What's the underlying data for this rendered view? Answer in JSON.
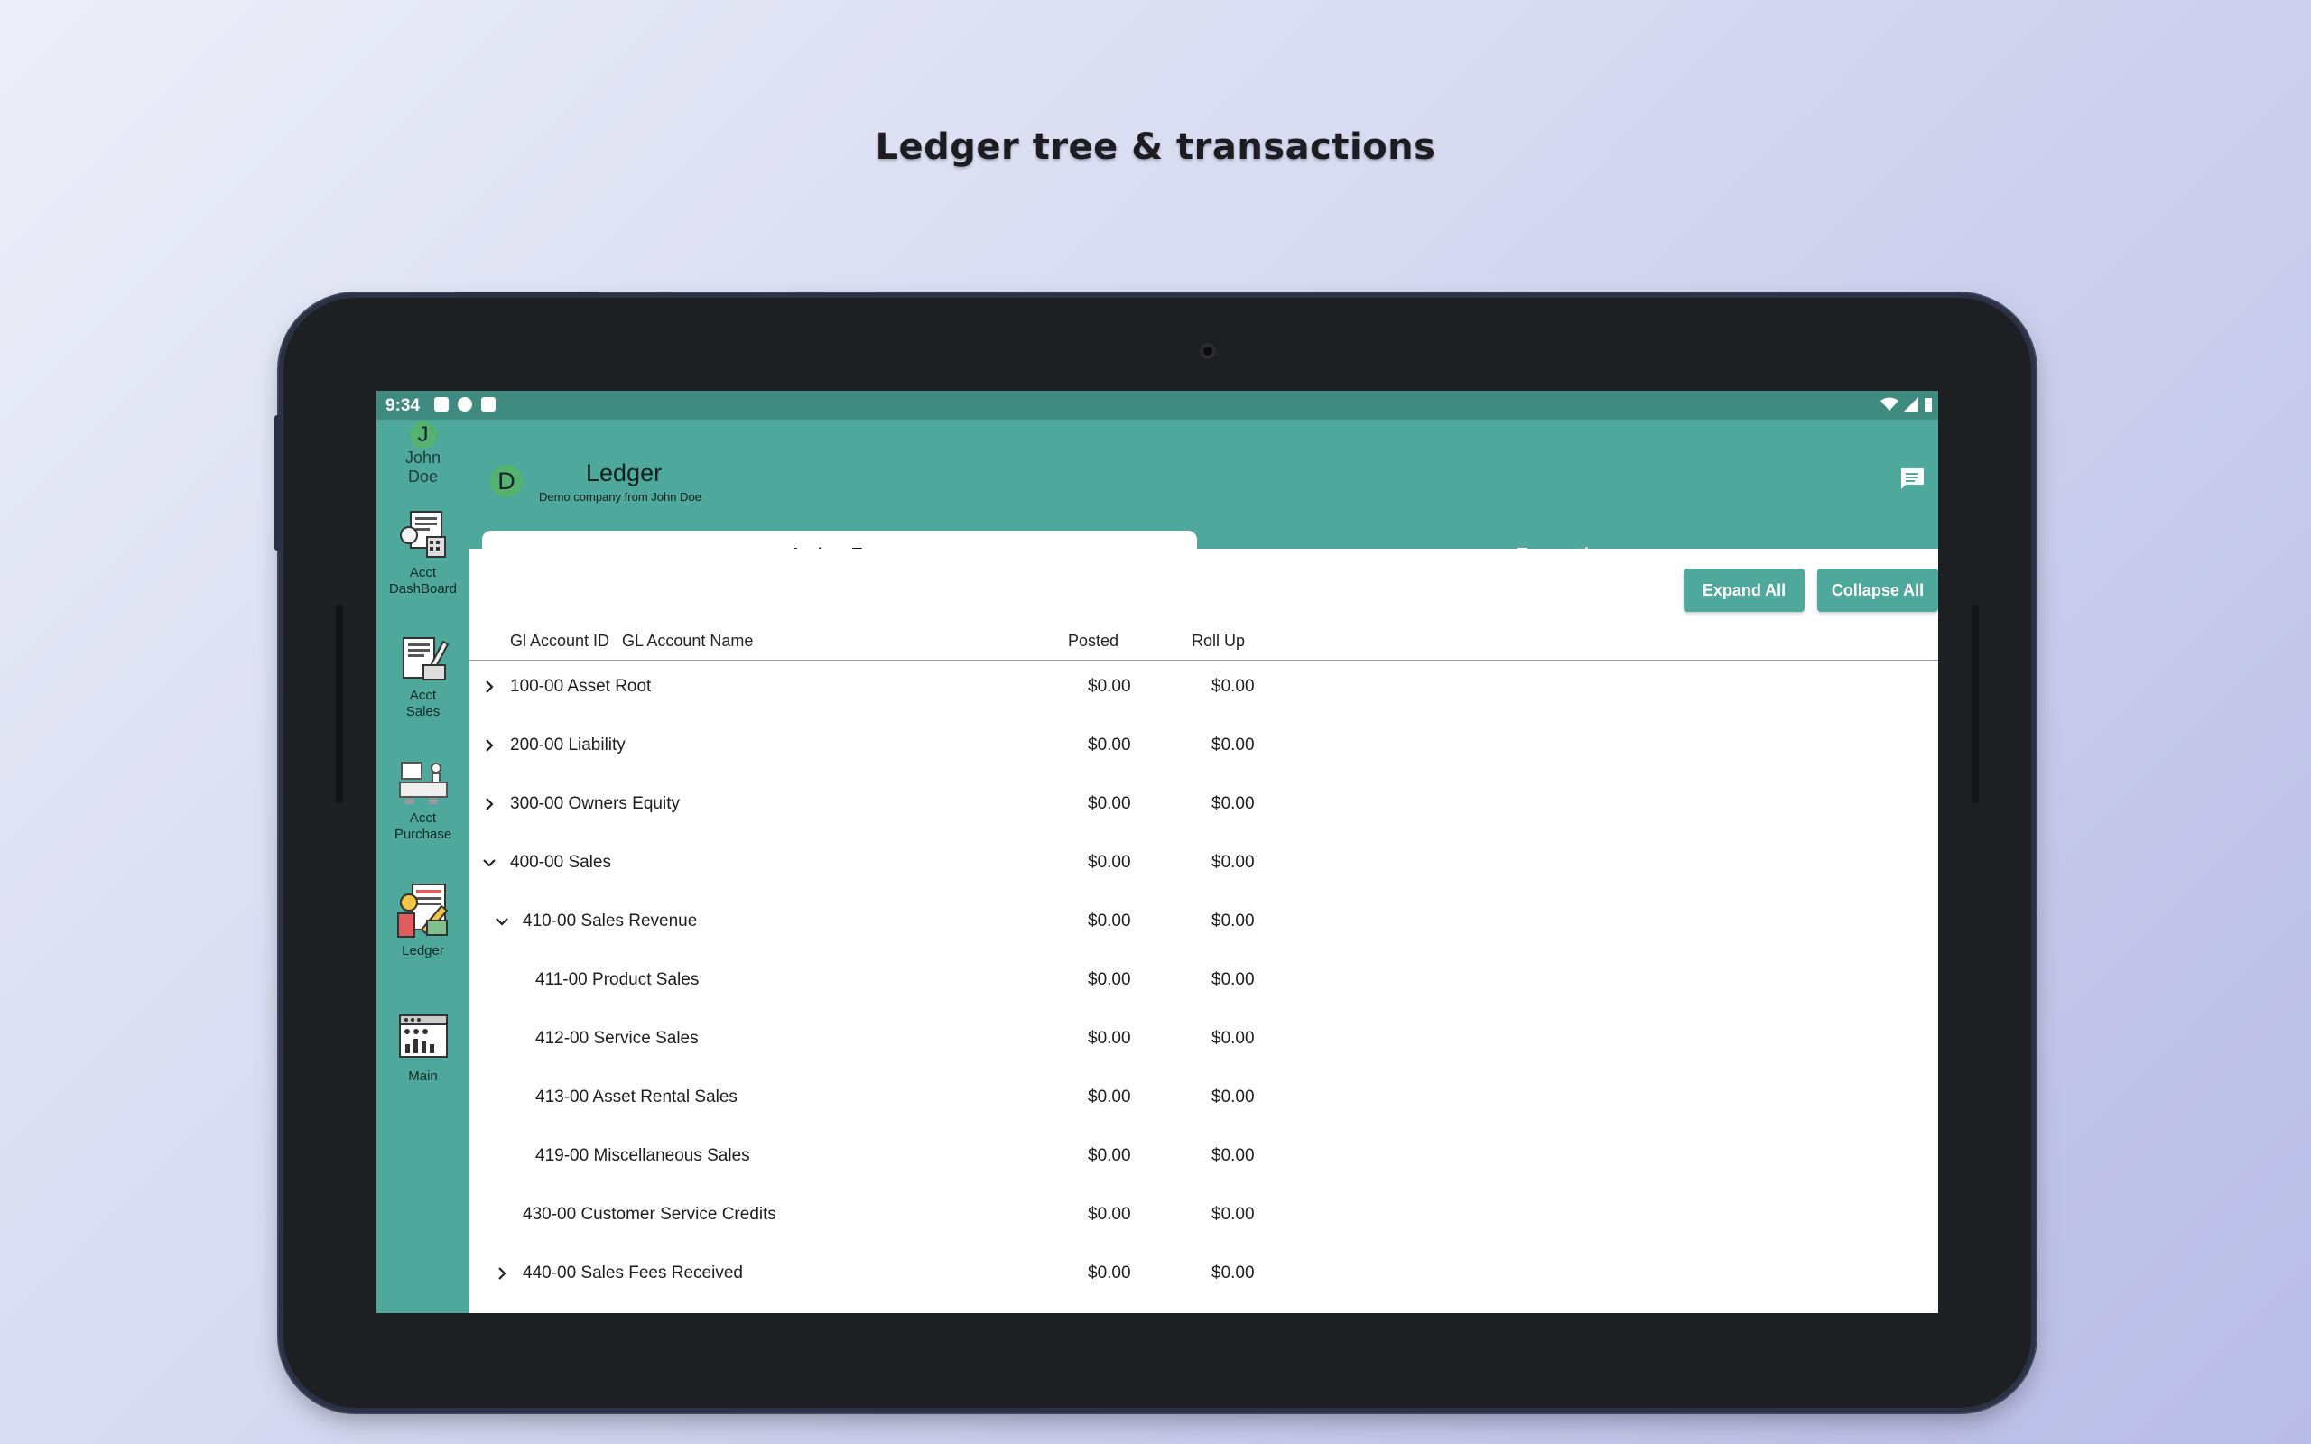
{
  "page": {
    "headline": "Ledger tree & transactions"
  },
  "status_bar": {
    "time": "9:34"
  },
  "user": {
    "initial": "J",
    "first": "John",
    "last": "Doe"
  },
  "rail": {
    "items": [
      {
        "line1": "Acct",
        "line2": "DashBoard",
        "icon": "dashboard-icon"
      },
      {
        "line1": "Acct",
        "line2": "Sales",
        "icon": "sales-icon"
      },
      {
        "line1": "Acct",
        "line2": "Purchase",
        "icon": "purchase-icon"
      },
      {
        "line1": "Ledger",
        "line2": "",
        "icon": "ledger-icon"
      },
      {
        "line1": "Main",
        "line2": "",
        "icon": "main-icon"
      }
    ]
  },
  "header": {
    "avatar": "D",
    "title": "Ledger",
    "subtitle": "Demo company from John Doe"
  },
  "tabs": [
    {
      "label": "Ledger Tree",
      "active": true
    },
    {
      "label": "Transactions",
      "active": false
    }
  ],
  "actions": {
    "expand": "Expand All",
    "collapse": "Collapse All"
  },
  "table": {
    "headers": {
      "id": "Gl Account ID",
      "name": "GL Account Name",
      "posted": "Posted",
      "rollup": "Roll Up"
    },
    "rows": [
      {
        "label": "100-00 Asset Root",
        "posted": "$0.00",
        "rollup": "$0.00",
        "chevron": "right",
        "level": 0
      },
      {
        "label": "200-00 Liability",
        "posted": "$0.00",
        "rollup": "$0.00",
        "chevron": "right",
        "level": 0
      },
      {
        "label": "300-00 Owners Equity",
        "posted": "$0.00",
        "rollup": "$0.00",
        "chevron": "right",
        "level": 0
      },
      {
        "label": "400-00 Sales",
        "posted": "$0.00",
        "rollup": "$0.00",
        "chevron": "down",
        "level": 0
      },
      {
        "label": "410-00 Sales Revenue",
        "posted": "$0.00",
        "rollup": "$0.00",
        "chevron": "down",
        "level": 1
      },
      {
        "label": "411-00 Product Sales",
        "posted": "$0.00",
        "rollup": "$0.00",
        "chevron": "none",
        "level": 2
      },
      {
        "label": "412-00 Service Sales",
        "posted": "$0.00",
        "rollup": "$0.00",
        "chevron": "none",
        "level": 2
      },
      {
        "label": "413-00 Asset Rental Sales",
        "posted": "$0.00",
        "rollup": "$0.00",
        "chevron": "none",
        "level": 2
      },
      {
        "label": "419-00 Miscellaneous Sales",
        "posted": "$0.00",
        "rollup": "$0.00",
        "chevron": "none",
        "level": 2
      },
      {
        "label": "430-00 Customer Service Credits",
        "posted": "$0.00",
        "rollup": "$0.00",
        "chevron": "none",
        "level": 1
      },
      {
        "label": "440-00 Sales Fees Received",
        "posted": "$0.00",
        "rollup": "$0.00",
        "chevron": "right",
        "level": 1
      }
    ]
  },
  "colors": {
    "primary": "#4ea89b",
    "status_bar": "#3f8b7f",
    "avatar": "#55b36e"
  }
}
